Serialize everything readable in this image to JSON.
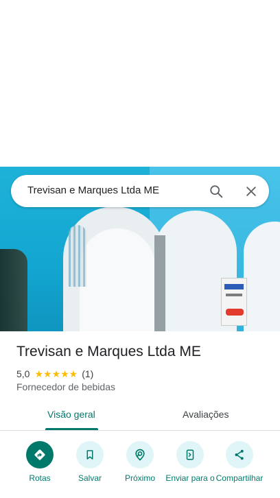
{
  "search": {
    "query": "Trevisan e Marques Ltda ME"
  },
  "place": {
    "name": "Trevisan e Marques Ltda ME",
    "rating": "5,0",
    "stars": "★★★★★",
    "stars_value": 5,
    "review_count": "(1)",
    "category": "Fornecedor de bebidas"
  },
  "tabs": [
    {
      "label": "Visão geral",
      "active": true
    },
    {
      "label": "Avaliações",
      "active": false
    }
  ],
  "actions": [
    {
      "label": "Rotas",
      "icon": "directions-icon"
    },
    {
      "label": "Salvar",
      "icon": "bookmark-icon"
    },
    {
      "label": "Próximo",
      "icon": "nearby-icon"
    },
    {
      "label": "Enviar para o",
      "icon": "send-to-phone-icon"
    },
    {
      "label": "Compartilhar",
      "icon": "share-icon"
    }
  ],
  "colors": {
    "accent": "#00796b",
    "action_bg": "#e0f5f7",
    "star": "#fbbc04"
  }
}
